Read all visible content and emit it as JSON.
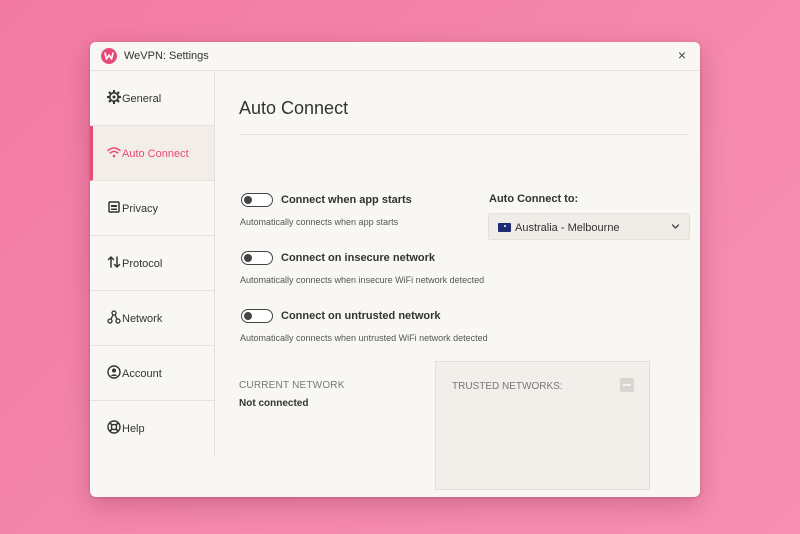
{
  "window": {
    "title": "WeVPN: Settings",
    "close_glyph": "×"
  },
  "sidebar": {
    "items": [
      {
        "label": "General",
        "icon": "gear-icon"
      },
      {
        "label": "Auto Connect",
        "icon": "wifi-icon",
        "active": true
      },
      {
        "label": "Privacy",
        "icon": "privacy-icon"
      },
      {
        "label": "Protocol",
        "icon": "protocol-icon"
      },
      {
        "label": "Network",
        "icon": "network-icon"
      },
      {
        "label": "Account",
        "icon": "account-icon"
      },
      {
        "label": "Help",
        "icon": "help-icon"
      }
    ]
  },
  "main": {
    "title": "Auto Connect",
    "options": [
      {
        "label": "Connect when app starts",
        "desc": "Automatically connects when app starts",
        "on": false
      },
      {
        "label": "Connect on insecure network",
        "desc": "Automatically connects when insecure WiFi network detected",
        "on": false
      },
      {
        "label": "Connect on untrusted network",
        "desc": "Automatically connects when untrusted WiFi network detected",
        "on": false
      }
    ],
    "auto_connect_to": {
      "label": "Auto Connect to:",
      "value": "Australia - Melbourne"
    },
    "current_network": {
      "label": "CURRENT NETWORK",
      "value": "Not connected"
    },
    "trusted_networks": {
      "label": "TRUSTED NETWORKS:"
    }
  },
  "colors": {
    "accent": "#e64a7b",
    "background": "#f27aa2",
    "window": "#f9f7f4"
  }
}
